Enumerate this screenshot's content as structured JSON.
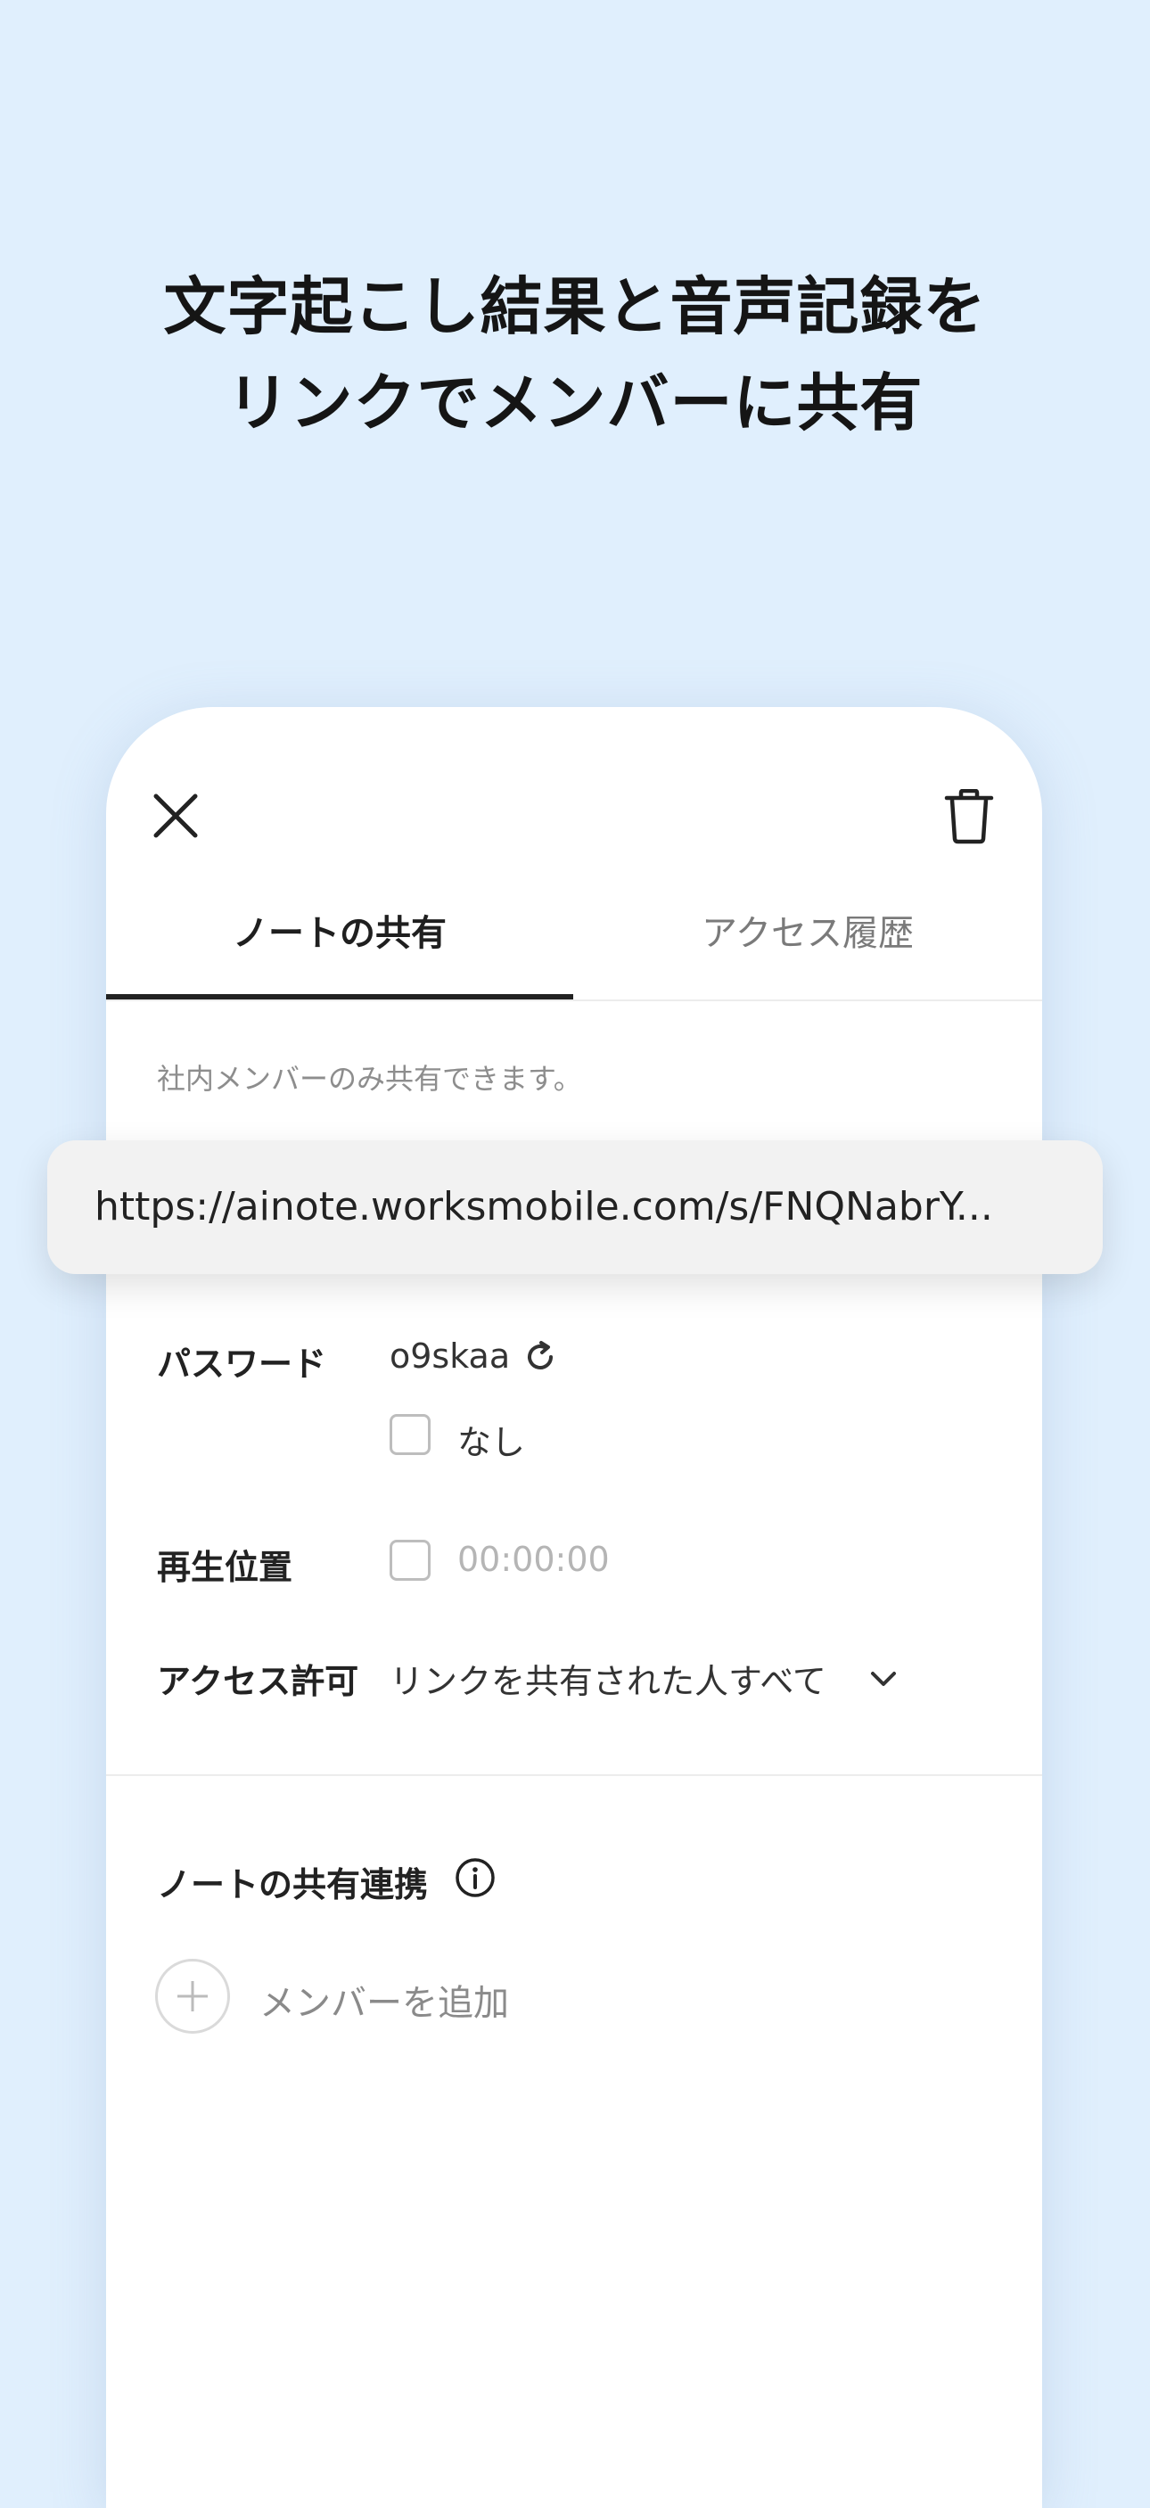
{
  "headline": {
    "line1": "文字起こし結果と音声記録を",
    "line2": "リンクでメンバーに共有"
  },
  "tabs": [
    {
      "label": "ノートの共有",
      "active": true
    },
    {
      "label": "アクセス履歴",
      "active": false
    }
  ],
  "notice": "社内メンバーのみ共有できます。",
  "share_url": "https://ainote.worksmobile.com/s/FNQNabrY...",
  "password": {
    "label": "パスワード",
    "value": "o9skaa",
    "none_label": "なし"
  },
  "playback": {
    "label": "再生位置",
    "time": "00:00:00"
  },
  "access": {
    "label": "アクセス許可",
    "value": "リンクを共有された人すべて"
  },
  "linked_share": {
    "label": "ノートの共有連携",
    "add_member": "メンバーを追加"
  },
  "icons": {
    "close": "close-icon",
    "trash": "trash-icon",
    "refresh": "refresh-icon",
    "chevron": "chevron-down-icon",
    "info": "info-icon",
    "plus": "plus-icon"
  },
  "colors": {
    "background": "#e0effd",
    "card": "#ffffff",
    "url_pill": "#f2f2f2",
    "active_tab_underline": "#222222"
  }
}
